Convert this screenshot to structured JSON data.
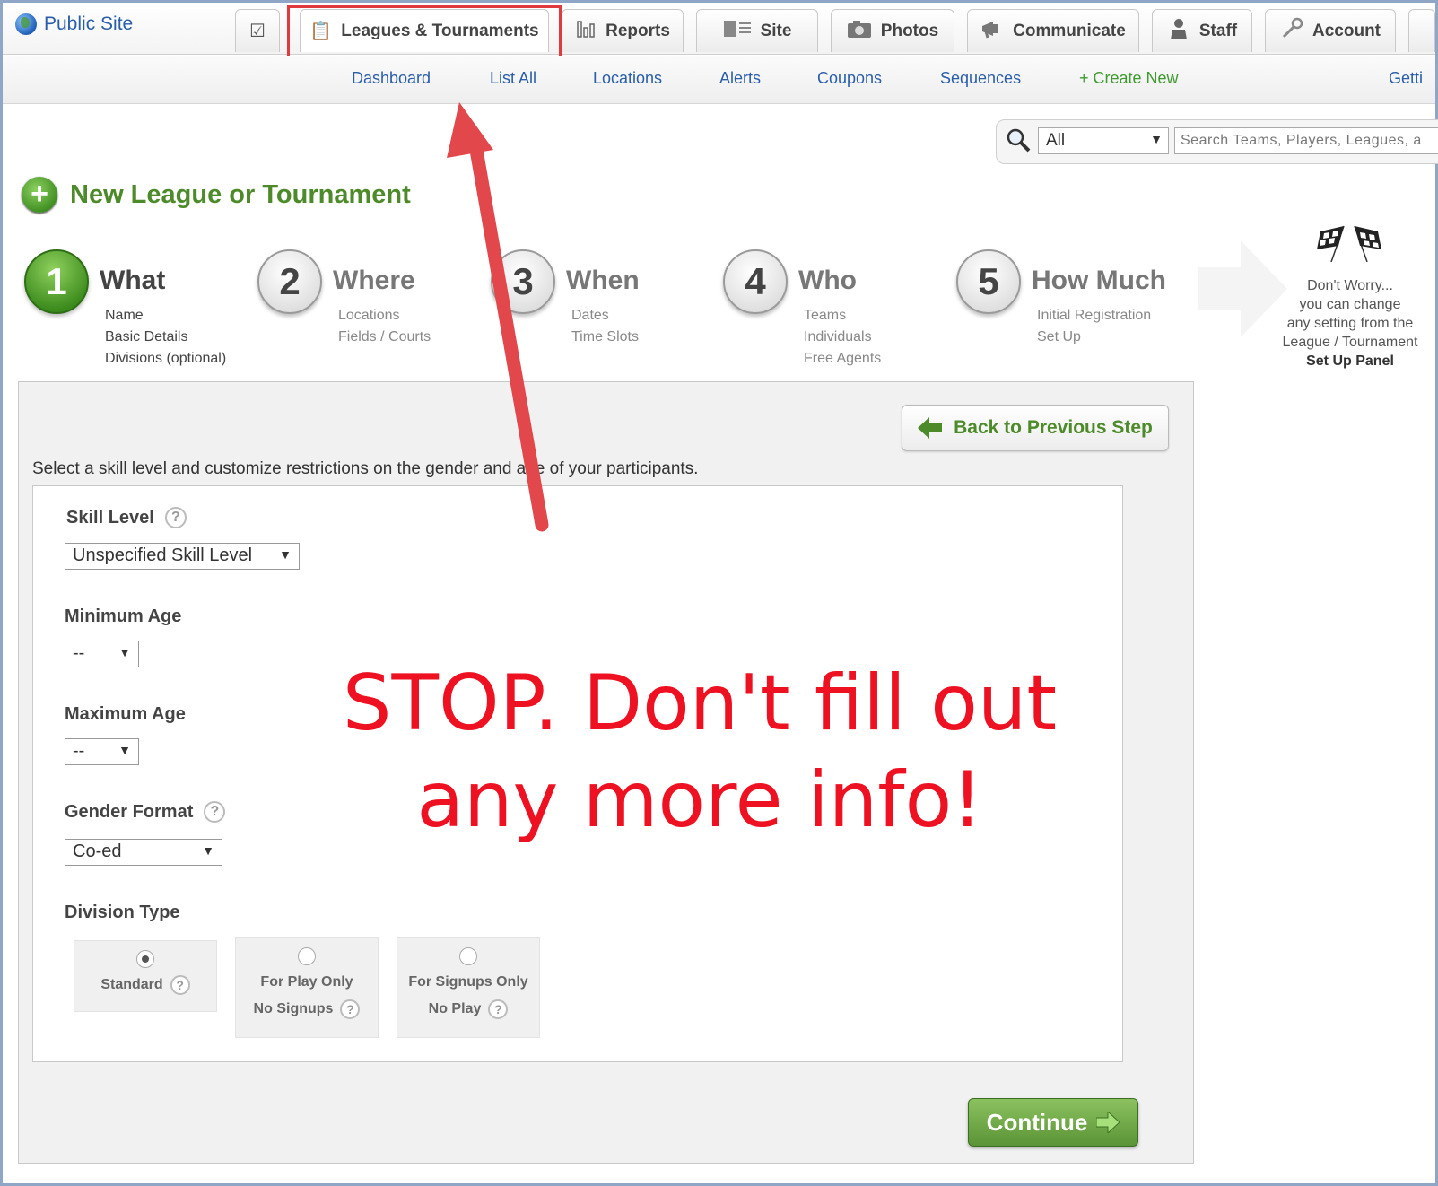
{
  "header": {
    "public_site": "Public Site",
    "tabs": [
      {
        "label": "Leagues & Tournaments",
        "icon": "clipboard-icon",
        "active": true
      },
      {
        "label": "Reports",
        "icon": "bar-chart-icon"
      },
      {
        "label": "Site",
        "icon": "site-icon"
      },
      {
        "label": "Photos",
        "icon": "camera-icon"
      },
      {
        "label": "Communicate",
        "icon": "megaphone-icon"
      },
      {
        "label": "Staff",
        "icon": "staff-icon"
      },
      {
        "label": "Account",
        "icon": "wrench-icon"
      }
    ]
  },
  "subnav": {
    "items": [
      "Dashboard",
      "List All",
      "Locations",
      "Alerts",
      "Coupons",
      "Sequences",
      "+ Create New",
      "Getti"
    ]
  },
  "search": {
    "scope": "All",
    "placeholder": "Search Teams, Players, Leagues, a"
  },
  "page": {
    "title": "New League or Tournament"
  },
  "steps": [
    {
      "num": "1",
      "label": "What",
      "sub": [
        "Name",
        "Basic Details",
        "Divisions (optional)"
      ]
    },
    {
      "num": "2",
      "label": "Where",
      "sub": [
        "Locations",
        "Fields / Courts"
      ]
    },
    {
      "num": "3",
      "label": "When",
      "sub": [
        "Dates",
        "Time Slots"
      ]
    },
    {
      "num": "4",
      "label": "Who",
      "sub": [
        "Teams",
        "Individuals",
        "Free Agents"
      ]
    },
    {
      "num": "5",
      "label": "How Much",
      "sub": [
        "Initial Registration",
        "Set Up"
      ]
    }
  ],
  "dont_worry": {
    "lines": [
      "Don't Worry...",
      "you can change",
      "any setting from the",
      "League / Tournament"
    ],
    "bold": "Set Up Panel"
  },
  "form": {
    "back_button": "Back to Previous Step",
    "intro": "Select a skill level and customize restrictions on the gender and age of your participants.",
    "skill_level_label": "Skill Level",
    "skill_level_value": "Unspecified Skill Level",
    "min_age_label": "Minimum Age",
    "min_age_value": "--",
    "max_age_label": "Maximum Age",
    "max_age_value": "--",
    "gender_label": "Gender Format",
    "gender_value": "Co-ed",
    "division_label": "Division Type",
    "division_options": [
      {
        "line1": "Standard",
        "line2": "",
        "selected": true
      },
      {
        "line1": "For Play Only",
        "line2": "No Signups",
        "selected": false
      },
      {
        "line1": "For Signups Only",
        "line2": "No Play",
        "selected": false
      }
    ],
    "continue_button": "Continue"
  },
  "annotation": {
    "line1": "STOP. Don't fill out",
    "line2": "any more info!",
    "color": "#ee1122"
  }
}
